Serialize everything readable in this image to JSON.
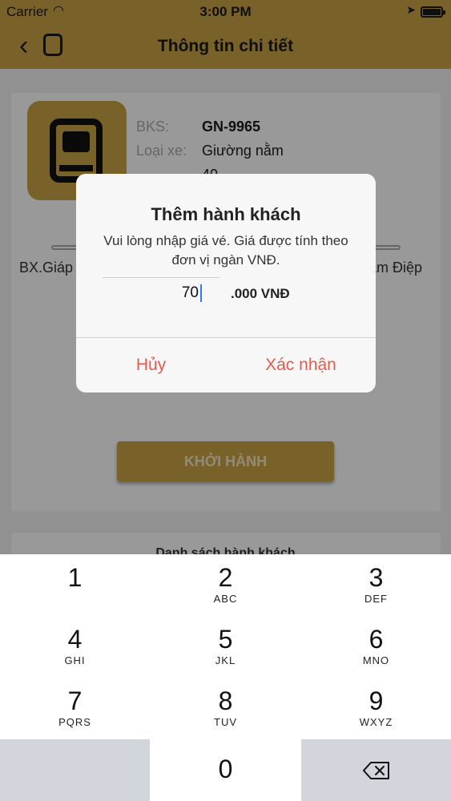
{
  "status_bar": {
    "carrier": "Carrier",
    "time": "3:00 PM"
  },
  "nav": {
    "title": "Thông tin chi tiết"
  },
  "vehicle": {
    "plate_label": "BKS:",
    "plate_value": "GN-9965",
    "type_label": "Loại xe:",
    "type_value": "Giường nằm",
    "seats_value": "40"
  },
  "route": {
    "from": "BX.Giáp",
    "to": "am Điệp"
  },
  "depart_button": "KHỞI HÀNH",
  "passenger_list_title": "Danh sách hành khách",
  "dialog": {
    "title": "Thêm hành khách",
    "message": "Vui lòng nhập giá vé. Giá được tính theo đơn vị ngàn VNĐ.",
    "input_value": "70",
    "unit": ".000 VNĐ",
    "cancel": "Hủy",
    "confirm": "Xác nhận"
  },
  "keypad": {
    "keys": [
      {
        "digit": "1",
        "letters": ""
      },
      {
        "digit": "2",
        "letters": "ABC"
      },
      {
        "digit": "3",
        "letters": "DEF"
      },
      {
        "digit": "4",
        "letters": "GHI"
      },
      {
        "digit": "5",
        "letters": "JKL"
      },
      {
        "digit": "6",
        "letters": "MNO"
      },
      {
        "digit": "7",
        "letters": "PQRS"
      },
      {
        "digit": "8",
        "letters": "TUV"
      },
      {
        "digit": "9",
        "letters": "WXYZ"
      },
      {
        "digit": "0",
        "letters": ""
      }
    ]
  },
  "colors": {
    "brand": "#c9a445",
    "alert_action": "#e55a4c",
    "keypad_gray": "#d2d5db"
  }
}
